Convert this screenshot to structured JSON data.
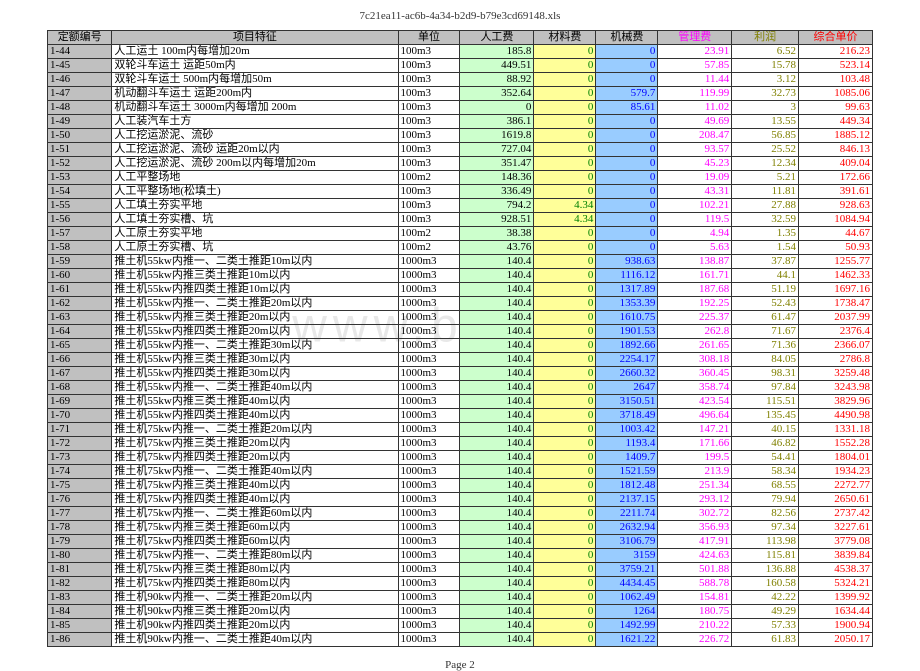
{
  "title": "7c21ea11-ac6b-4a34-b2d9-b79e3cd69148.xls",
  "footer": "Page 2",
  "watermark": "www.bdoc.in",
  "headers": [
    "定额编号",
    "项目特征",
    "单位",
    "人工费",
    "材料费",
    "机械费",
    "管理费",
    "利润",
    "综合单价"
  ],
  "rows": [
    [
      "1-44",
      "人工运土 100m内每增加20m",
      "100m3",
      "185.8",
      "0",
      "0",
      "23.91",
      "6.52",
      "216.23"
    ],
    [
      "1-45",
      "双轮斗车运土 运距50m内",
      "100m3",
      "449.51",
      "0",
      "0",
      "57.85",
      "15.78",
      "523.14"
    ],
    [
      "1-46",
      "双轮斗车运土 500m内每增加50m",
      "100m3",
      "88.92",
      "0",
      "0",
      "11.44",
      "3.12",
      "103.48"
    ],
    [
      "1-47",
      "机动翻斗车运土 运距200m内",
      "100m3",
      "352.64",
      "0",
      "579.7",
      "119.99",
      "32.73",
      "1085.06"
    ],
    [
      "1-48",
      "机动翻斗车运土 3000m内每增加 200m",
      "100m3",
      "0",
      "0",
      "85.61",
      "11.02",
      "3",
      "99.63"
    ],
    [
      "1-49",
      "人工装汽车土方",
      "100m3",
      "386.1",
      "0",
      "0",
      "49.69",
      "13.55",
      "449.34"
    ],
    [
      "1-50",
      "人工挖运淤泥、流砂",
      "100m3",
      "1619.8",
      "0",
      "0",
      "208.47",
      "56.85",
      "1885.12"
    ],
    [
      "1-51",
      "人工挖运淤泥、流砂 运距20m以内",
      "100m3",
      "727.04",
      "0",
      "0",
      "93.57",
      "25.52",
      "846.13"
    ],
    [
      "1-52",
      "人工挖运淤泥、流砂 200m以内每增加20m",
      "100m3",
      "351.47",
      "0",
      "0",
      "45.23",
      "12.34",
      "409.04"
    ],
    [
      "1-53",
      "人工平整场地",
      "100m2",
      "148.36",
      "0",
      "0",
      "19.09",
      "5.21",
      "172.66"
    ],
    [
      "1-54",
      "人工平整场地(松填土)",
      "100m3",
      "336.49",
      "0",
      "0",
      "43.31",
      "11.81",
      "391.61"
    ],
    [
      "1-55",
      "人工填土夯实平地",
      "100m3",
      "794.2",
      "4.34",
      "0",
      "102.21",
      "27.88",
      "928.63"
    ],
    [
      "1-56",
      "人工填土夯实槽、坑",
      "100m3",
      "928.51",
      "4.34",
      "0",
      "119.5",
      "32.59",
      "1084.94"
    ],
    [
      "1-57",
      "人工原土夯实平地",
      "100m2",
      "38.38",
      "0",
      "0",
      "4.94",
      "1.35",
      "44.67"
    ],
    [
      "1-58",
      "人工原土夯实槽、坑",
      "100m2",
      "43.76",
      "0",
      "0",
      "5.63",
      "1.54",
      "50.93"
    ],
    [
      "1-59",
      "推土机55kw内推一、二类土推距10m以内",
      "1000m3",
      "140.4",
      "0",
      "938.63",
      "138.87",
      "37.87",
      "1255.77"
    ],
    [
      "1-60",
      "推土机55kw内推三类土推距10m以内",
      "1000m3",
      "140.4",
      "0",
      "1116.12",
      "161.71",
      "44.1",
      "1462.33"
    ],
    [
      "1-61",
      "推土机55kw内推四类土推距10m以内",
      "1000m3",
      "140.4",
      "0",
      "1317.89",
      "187.68",
      "51.19",
      "1697.16"
    ],
    [
      "1-62",
      "推土机55kw内推一、二类土推距20m以内",
      "1000m3",
      "140.4",
      "0",
      "1353.39",
      "192.25",
      "52.43",
      "1738.47"
    ],
    [
      "1-63",
      "推土机55kw内推三类土推距20m以内",
      "1000m3",
      "140.4",
      "0",
      "1610.75",
      "225.37",
      "61.47",
      "2037.99"
    ],
    [
      "1-64",
      "推土机55kw内推四类土推距20m以内",
      "1000m3",
      "140.4",
      "0",
      "1901.53",
      "262.8",
      "71.67",
      "2376.4"
    ],
    [
      "1-65",
      "推土机55kw内推一、二类土推距30m以内",
      "1000m3",
      "140.4",
      "0",
      "1892.66",
      "261.65",
      "71.36",
      "2366.07"
    ],
    [
      "1-66",
      "推土机55kw内推三类土推距30m以内",
      "1000m3",
      "140.4",
      "0",
      "2254.17",
      "308.18",
      "84.05",
      "2786.8"
    ],
    [
      "1-67",
      "推土机55kw内推四类土推距30m以内",
      "1000m3",
      "140.4",
      "0",
      "2660.32",
      "360.45",
      "98.31",
      "3259.48"
    ],
    [
      "1-68",
      "推土机55kw内推一、二类土推距40m以内",
      "1000m3",
      "140.4",
      "0",
      "2647",
      "358.74",
      "97.84",
      "3243.98"
    ],
    [
      "1-69",
      "推土机55kw内推三类土推距40m以内",
      "1000m3",
      "140.4",
      "0",
      "3150.51",
      "423.54",
      "115.51",
      "3829.96"
    ],
    [
      "1-70",
      "推土机55kw内推四类土推距40m以内",
      "1000m3",
      "140.4",
      "0",
      "3718.49",
      "496.64",
      "135.45",
      "4490.98"
    ],
    [
      "1-71",
      "推土机75kw内推一、二类土推距20m以内",
      "1000m3",
      "140.4",
      "0",
      "1003.42",
      "147.21",
      "40.15",
      "1331.18"
    ],
    [
      "1-72",
      "推土机75kw内推三类土推距20m以内",
      "1000m3",
      "140.4",
      "0",
      "1193.4",
      "171.66",
      "46.82",
      "1552.28"
    ],
    [
      "1-73",
      "推土机75kw内推四类土推距20m以内",
      "1000m3",
      "140.4",
      "0",
      "1409.7",
      "199.5",
      "54.41",
      "1804.01"
    ],
    [
      "1-74",
      "推土机75kw内推一、二类土推距40m以内",
      "1000m3",
      "140.4",
      "0",
      "1521.59",
      "213.9",
      "58.34",
      "1934.23"
    ],
    [
      "1-75",
      "推土机75kw内推三类土推距40m以内",
      "1000m3",
      "140.4",
      "0",
      "1812.48",
      "251.34",
      "68.55",
      "2272.77"
    ],
    [
      "1-76",
      "推土机75kw内推四类土推距40m以内",
      "1000m3",
      "140.4",
      "0",
      "2137.15",
      "293.12",
      "79.94",
      "2650.61"
    ],
    [
      "1-77",
      "推土机75kw内推一、二类土推距60m以内",
      "1000m3",
      "140.4",
      "0",
      "2211.74",
      "302.72",
      "82.56",
      "2737.42"
    ],
    [
      "1-78",
      "推土机75kw内推三类土推距60m以内",
      "1000m3",
      "140.4",
      "0",
      "2632.94",
      "356.93",
      "97.34",
      "3227.61"
    ],
    [
      "1-79",
      "推土机75kw内推四类土推距60m以内",
      "1000m3",
      "140.4",
      "0",
      "3106.79",
      "417.91",
      "113.98",
      "3779.08"
    ],
    [
      "1-80",
      "推土机75kw内推一、二类土推距80m以内",
      "1000m3",
      "140.4",
      "0",
      "3159",
      "424.63",
      "115.81",
      "3839.84"
    ],
    [
      "1-81",
      "推土机75kw内推三类土推距80m以内",
      "1000m3",
      "140.4",
      "0",
      "3759.21",
      "501.88",
      "136.88",
      "4538.37"
    ],
    [
      "1-82",
      "推土机75kw内推四类土推距80m以内",
      "1000m3",
      "140.4",
      "0",
      "4434.45",
      "588.78",
      "160.58",
      "5324.21"
    ],
    [
      "1-83",
      "推土机90kw内推一、二类土推距20m以内",
      "1000m3",
      "140.4",
      "0",
      "1062.49",
      "154.81",
      "42.22",
      "1399.92"
    ],
    [
      "1-84",
      "推土机90kw内推三类土推距20m以内",
      "1000m3",
      "140.4",
      "0",
      "1264",
      "180.75",
      "49.29",
      "1634.44"
    ],
    [
      "1-85",
      "推土机90kw内推四类土推距20m以内",
      "1000m3",
      "140.4",
      "0",
      "1492.99",
      "210.22",
      "57.33",
      "1900.94"
    ],
    [
      "1-86",
      "推土机90kw内推一、二类土推距40m以内",
      "1000m3",
      "140.4",
      "0",
      "1621.22",
      "226.72",
      "61.83",
      "2050.17"
    ]
  ]
}
